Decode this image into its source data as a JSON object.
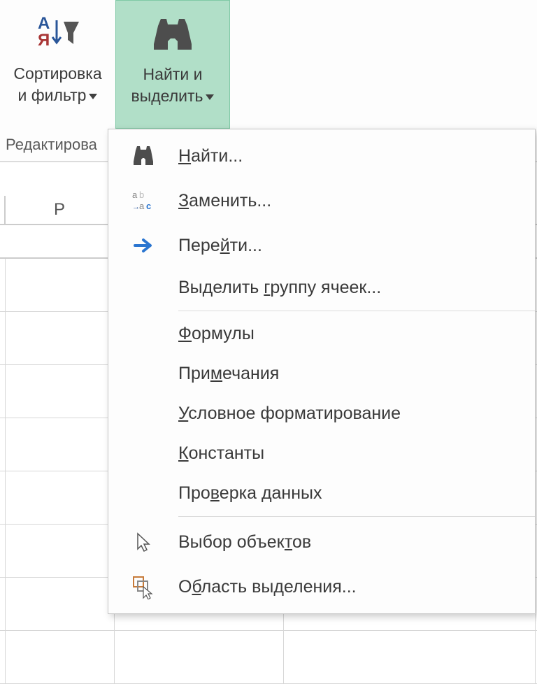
{
  "ribbon": {
    "sort_filter": {
      "line1": "Сортировка",
      "line2": "и фильтр"
    },
    "find_select": {
      "line1": "Найти и",
      "line2": "выделить"
    },
    "group_label": "Редактирова"
  },
  "columns": {
    "p": "P"
  },
  "menu": {
    "items": [
      {
        "label_pre": "",
        "u": "Н",
        "label_post": "айти...",
        "icon": "binoculars"
      },
      {
        "label_pre": "",
        "u": "З",
        "label_post": "аменить...",
        "icon": "replace"
      },
      {
        "label_pre": "Пере",
        "u": "й",
        "label_post": "ти...",
        "icon": "arrow"
      },
      {
        "label_pre": "Выделить ",
        "u": "г",
        "label_post": "руппу ячеек...",
        "icon": ""
      },
      {
        "sep": true
      },
      {
        "label_pre": "",
        "u": "Ф",
        "label_post": "ормулы",
        "icon": ""
      },
      {
        "label_pre": "При",
        "u": "м",
        "label_post": "ечания",
        "icon": ""
      },
      {
        "label_pre": "",
        "u": "У",
        "label_post": "словное форматирование",
        "icon": ""
      },
      {
        "label_pre": "",
        "u": "К",
        "label_post": "онстанты",
        "icon": ""
      },
      {
        "label_pre": "Про",
        "u": "в",
        "label_post": "ерка данных",
        "icon": ""
      },
      {
        "sep": true
      },
      {
        "label_pre": "Выбор объек",
        "u": "т",
        "label_post": "ов",
        "icon": "cursor"
      },
      {
        "label_pre": "О",
        "u": "б",
        "label_post": "ласть выделения...",
        "icon": "selection-pane"
      }
    ]
  }
}
